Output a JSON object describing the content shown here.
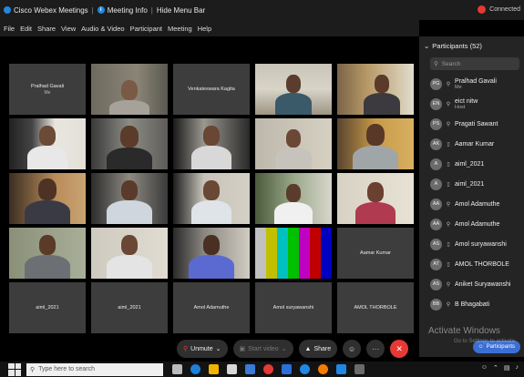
{
  "titlebar": {
    "app_title": "Cisco Webex Meetings",
    "meeting_info": "Meeting Info",
    "hide_menu": "Hide Menu Bar",
    "connection": "Connected"
  },
  "menu": [
    "File",
    "Edit",
    "Share",
    "View",
    "Audio & Video",
    "Participant",
    "Meeting",
    "Help"
  ],
  "tiles": {
    "r1c1": {
      "name": "Pralhad Gavali",
      "role": "Me"
    },
    "r1c3": {
      "name": "Venkateswara Kagita"
    },
    "r4c5": {
      "name": "Aamar Kumar"
    },
    "r5c1": {
      "name": "aiml_2021"
    },
    "r5c2": {
      "name": "aiml_2021"
    },
    "r5c3": {
      "name": "Amol Adamuthe"
    },
    "r5c4": {
      "name": "Amol suryawanshi"
    },
    "r5c5": {
      "name": "AMOL THORBOLE"
    }
  },
  "panel": {
    "header": "Participants (52)",
    "search_placeholder": "Search",
    "participants": [
      {
        "initials": "PG",
        "name": "Pralhad Gavali",
        "role": "Me",
        "device": "mic"
      },
      {
        "initials": "EN",
        "name": "eict nitw",
        "role": "Host",
        "device": "mic"
      },
      {
        "initials": "PS",
        "name": "Pragati Sawant",
        "device": "mic"
      },
      {
        "initials": "AK",
        "name": "Aamar Kumar",
        "device": "phone"
      },
      {
        "initials": "A",
        "name": "aiml_2021",
        "device": "phone"
      },
      {
        "initials": "A",
        "name": "aiml_2021",
        "device": "phone"
      },
      {
        "initials": "AA",
        "name": "Amol Adamuthe",
        "device": "mic"
      },
      {
        "initials": "AA",
        "name": "Amol Adamuthe",
        "device": "mic"
      },
      {
        "initials": "AS",
        "name": "Amol suryawanshi",
        "device": "phone"
      },
      {
        "initials": "AT",
        "name": "AMOL THORBOLE",
        "device": "phone"
      },
      {
        "initials": "AS",
        "name": "Aniket Suryawanshi",
        "device": "mic"
      },
      {
        "initials": "BB",
        "name": "B Bhagabati",
        "device": "mic"
      }
    ],
    "footer_button": "Participants"
  },
  "watermark": {
    "line1": "Activate Windows",
    "line2": "Go to Settings to activate"
  },
  "controls": {
    "unmute": "Unmute",
    "start_video": "Start video",
    "share": "Share"
  },
  "taskbar": {
    "search_placeholder": "Type here to search"
  },
  "colors": {
    "end_button": "#e53935",
    "accent": "#1e88e5",
    "participants_button": "#3b6fd6"
  }
}
